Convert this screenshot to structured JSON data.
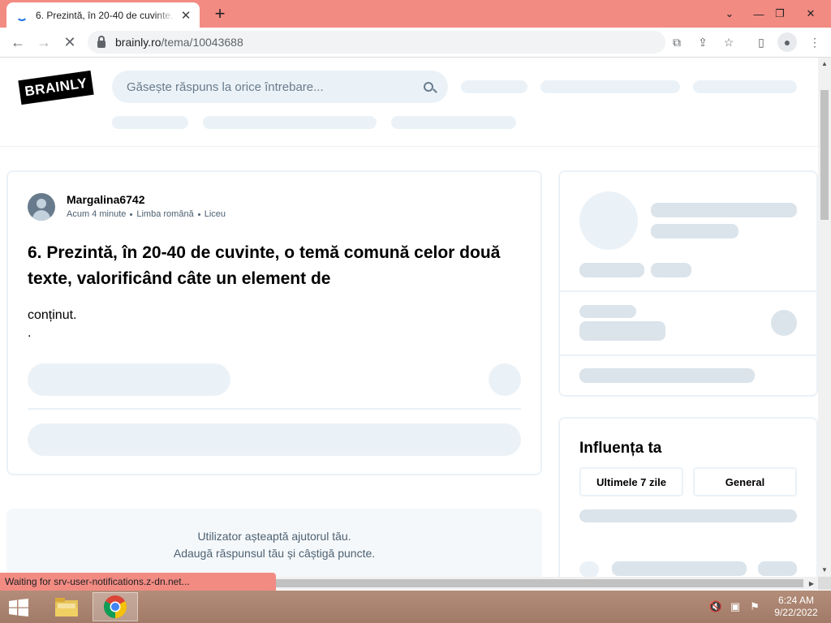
{
  "browser": {
    "tab_title": "6. Prezintă, în 20-40 de cuvinte, o temă comună celor două texte",
    "url_domain": "brainly.ro",
    "url_path": "/tema/10043688",
    "status_text": "Waiting for srv-user-notifications.z-dn.net..."
  },
  "site": {
    "logo": "BRAINLY",
    "search_placeholder": "Găsește răspuns la orice întrebare..."
  },
  "question": {
    "author": "Margalina6742",
    "time": "Acum 4 minute",
    "subject": "Limba română",
    "level": "Liceu",
    "title": "6. Prezintă, în 20-40 de cuvinte, o temă comună celor două texte, valorificând câte un element de",
    "body_line1": "conținut.",
    "body_line2": "."
  },
  "answer_prompt": {
    "line1": "Utilizator așteaptă ajutorul tău.",
    "line2": "Adaugă răspunsul tău și câștigă puncte."
  },
  "influence": {
    "title": "Influența ta",
    "tab_week": "Ultimele 7 zile",
    "tab_general": "General"
  },
  "taskbar": {
    "time": "6:24 AM",
    "date": "9/22/2022"
  },
  "colors": {
    "titlebar": "#f28b82",
    "skeleton": "#dbe4eb",
    "skeleton_light": "#ebf2f7",
    "text_muted": "#4d6172"
  },
  "icons": [
    "loading-spinner-icon",
    "close-icon",
    "plus-icon",
    "back-icon",
    "forward-icon",
    "stop-icon",
    "lock-icon",
    "translate-icon",
    "share-icon",
    "star-icon",
    "sidepanel-icon",
    "profile-icon",
    "more-icon",
    "search-icon",
    "windows-start-icon",
    "file-explorer-icon",
    "chrome-icon",
    "volume-muted-icon",
    "network-icon",
    "flag-icon"
  ]
}
